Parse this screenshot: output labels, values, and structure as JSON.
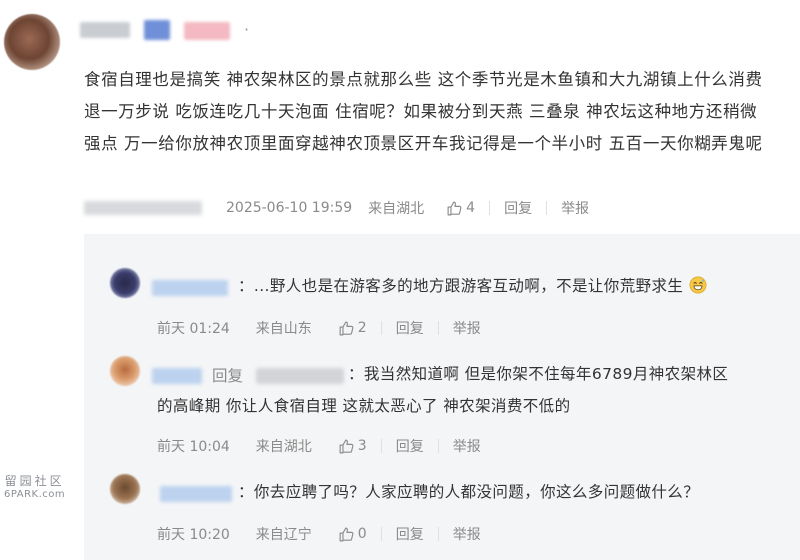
{
  "main_comment": {
    "text": "食宿自理也是搞笑 神农架林区的景点就那么些 这个季节光是木鱼镇和大九湖镇上什么消费 退一万步说 吃饭连吃几十天泡面 住宿呢？如果被分到天燕 三叠泉 神农坛这种地方还稍微强点 万一给你放神农顶里面穿越神农顶景区开车我记得是一个半小时 五百一天你糊弄鬼呢",
    "dot": "·",
    "time": "2025-06-10 19:59",
    "location": "来自湖北",
    "likes": "4",
    "reply_label": "回复",
    "report_label": "举报"
  },
  "replies": [
    {
      "colon": "：",
      "text": "...野人也是在游客多的地方跟游客互动啊，不是让你荒野求生",
      "emoji": "grinning-sweat-emoji",
      "time": "前天 01:24",
      "location": "来自山东",
      "likes": "2",
      "reply_label": "回复",
      "report_label": "举报"
    },
    {
      "reply_prefix": "回复",
      "colon": "：",
      "text_line1": "我当然知道啊 但是你架不住每年6789月神农架林区",
      "text_line2": "的高峰期 你让人食宿自理 这就太恶心了 神农架消费不低的",
      "time": "前天 10:04",
      "location": "来自湖北",
      "likes": "3",
      "reply_label": "回复",
      "report_label": "举报"
    },
    {
      "colon": "：",
      "text": "你去应聘了吗？人家应聘的人都没问题，你这么多问题做什么？",
      "time": "前天 10:20",
      "location": "来自辽宁",
      "likes": "0",
      "reply_label": "回复",
      "report_label": "举报"
    }
  ],
  "watermark": {
    "line1": "留园社区",
    "line2": "6PARK.com"
  },
  "colors": {
    "text": "#333333",
    "meta": "#8a8a8a",
    "reply_bg": "#f4f5f7"
  }
}
